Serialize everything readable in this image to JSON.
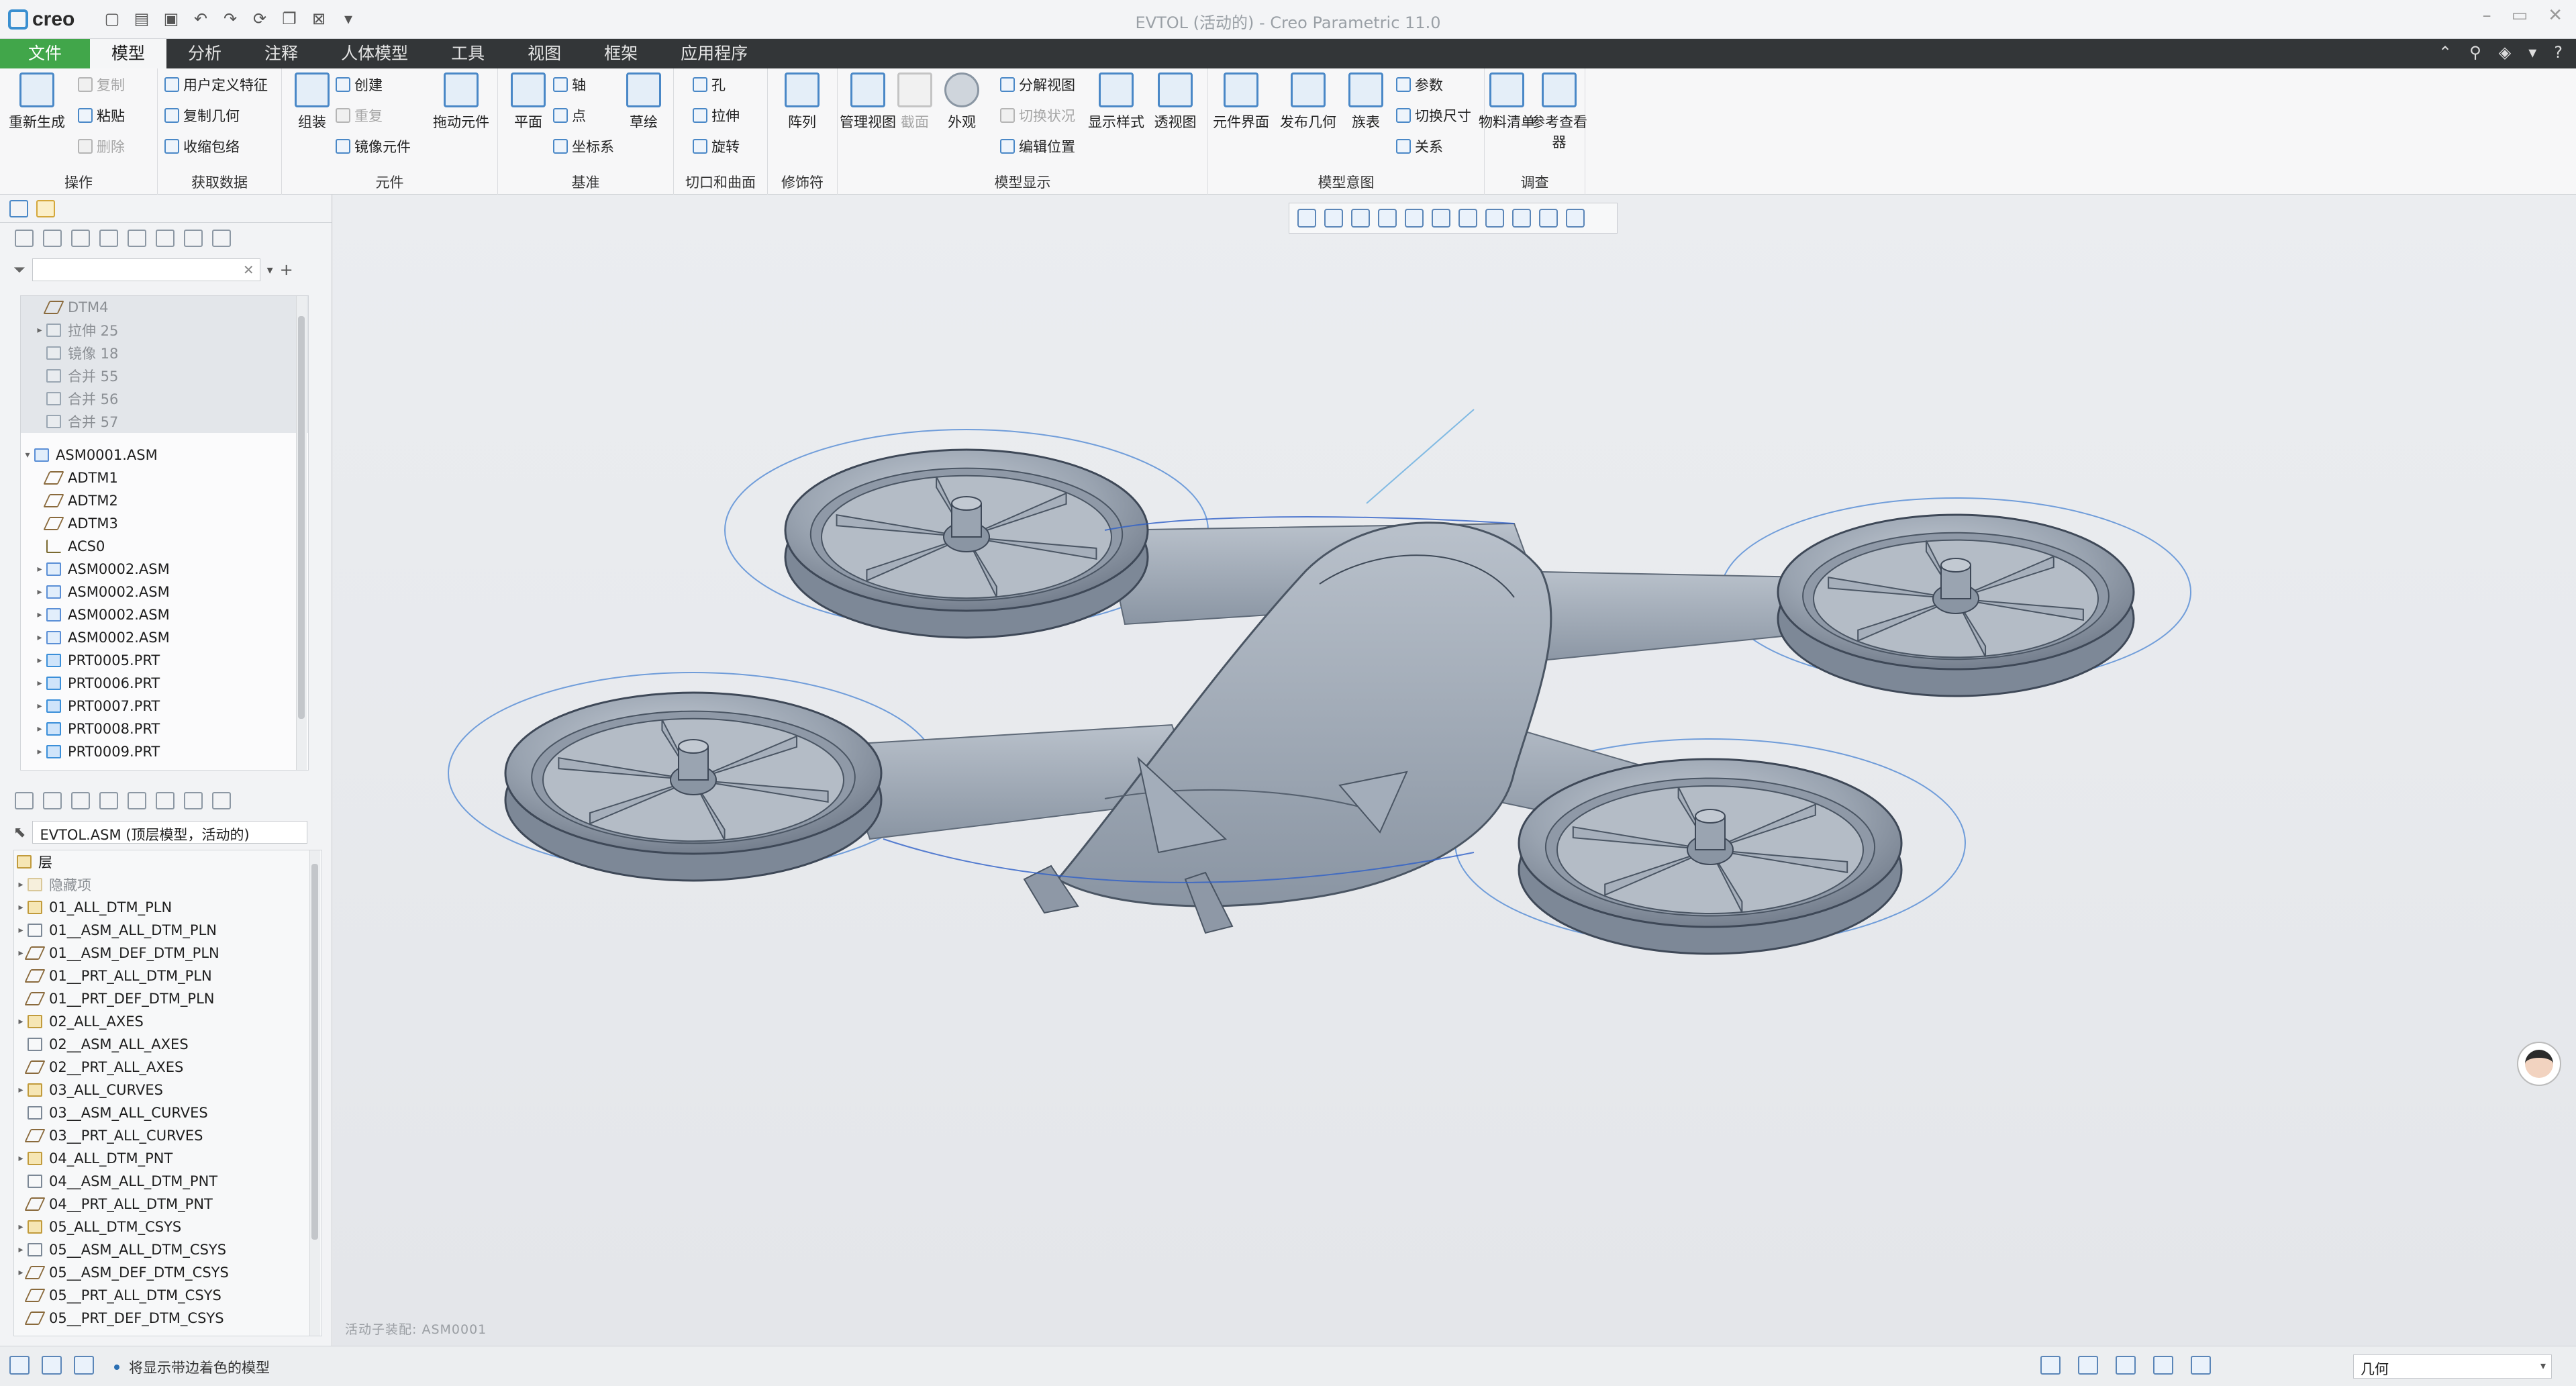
{
  "app": {
    "logo_text": "creo",
    "window_title": "EVTOL (活动的) - Creo Parametric 11.0"
  },
  "tabs": [
    "文件",
    "模型",
    "分析",
    "注释",
    "人体模型",
    "工具",
    "视图",
    "框架",
    "应用程序"
  ],
  "ribbon": {
    "groups": {
      "operations": "操作",
      "get_data": "获取数据",
      "component": "元件",
      "datum": "基准",
      "cut_surface": "切口和曲面",
      "modifiers": "修饰符",
      "model_display": "模型显示",
      "model_intent": "模型意图",
      "investigate": "调查"
    },
    "buttons": {
      "regenerate": "重新生成",
      "copy": "复制",
      "paste": "粘贴",
      "delete": "删除",
      "udf": "用户定义特征",
      "copy_geom": "复制几何",
      "shrinkwrap": "收缩包络",
      "assemble": "组装",
      "create": "创建",
      "repeat": "重复",
      "mirror_comp": "镜像元件",
      "drag_comp": "拖动元件",
      "plane": "平面",
      "axis": "轴",
      "point": "点",
      "csys": "坐标系",
      "sketch": "草绘",
      "hole": "孔",
      "extrude": "拉伸",
      "revolve": "旋转",
      "pattern": "阵列",
      "manage_views": "管理视图",
      "section": "截面",
      "appearance": "外观",
      "explode_view": "分解视图",
      "toggle_state": "切换状况",
      "edit_position": "编辑位置",
      "display_style": "显示样式",
      "perspective": "透视图",
      "comp_interface": "元件界面",
      "publish_geom": "发布几何",
      "family_table": "族表",
      "params": "参数",
      "switch_dims": "切换尺寸",
      "relations": "关系",
      "bom": "物料清单",
      "ref_viewer": "参考查看器"
    }
  },
  "model_tree": {
    "search_placeholder": "",
    "top_items": [
      {
        "label": "DTM4",
        "icon": "plane",
        "dim": true
      },
      {
        "label": "拉伸 25",
        "icon": "feat",
        "dim": true,
        "expandable": true
      },
      {
        "label": "镜像 18",
        "icon": "feat",
        "dim": true
      },
      {
        "label": "合并 55",
        "icon": "feat",
        "dim": true
      },
      {
        "label": "合并 56",
        "icon": "feat",
        "dim": true
      },
      {
        "label": "合并 57",
        "icon": "feat",
        "dim": true
      }
    ],
    "assembly": "ASM0001.ASM",
    "children": [
      {
        "label": "ADTM1",
        "icon": "plane"
      },
      {
        "label": "ADTM2",
        "icon": "plane"
      },
      {
        "label": "ADTM3",
        "icon": "plane"
      },
      {
        "label": "ACS0",
        "icon": "csys"
      },
      {
        "label": "ASM0002.ASM",
        "icon": "asm",
        "expandable": true
      },
      {
        "label": "ASM0002.ASM",
        "icon": "asm",
        "expandable": true
      },
      {
        "label": "ASM0002.ASM",
        "icon": "asm",
        "expandable": true
      },
      {
        "label": "ASM0002.ASM",
        "icon": "asm",
        "expandable": true
      },
      {
        "label": "PRT0005.PRT",
        "icon": "prt",
        "expandable": true
      },
      {
        "label": "PRT0006.PRT",
        "icon": "prt",
        "expandable": true
      },
      {
        "label": "PRT0007.PRT",
        "icon": "prt",
        "expandable": true
      },
      {
        "label": "PRT0008.PRT",
        "icon": "prt",
        "expandable": true
      },
      {
        "label": "PRT0009.PRT",
        "icon": "prt",
        "expandable": true
      }
    ]
  },
  "layer_tree": {
    "model_select": "EVTOL.ASM (顶层模型，活动的)",
    "root": "层",
    "items": [
      {
        "label": "隐藏项",
        "icon": "layerdim",
        "dim": true,
        "expandable": true
      },
      {
        "label": "01_ALL_DTM_PLN",
        "icon": "layer",
        "expandable": true
      },
      {
        "label": "01__ASM_ALL_DTM_PLN",
        "icon": "rule",
        "expandable": true
      },
      {
        "label": "01__ASM_DEF_DTM_PLN",
        "icon": "plane",
        "expandable": true
      },
      {
        "label": "01__PRT_ALL_DTM_PLN",
        "icon": "plane"
      },
      {
        "label": "01__PRT_DEF_DTM_PLN",
        "icon": "plane"
      },
      {
        "label": "02_ALL_AXES",
        "icon": "layer",
        "expandable": true
      },
      {
        "label": "02__ASM_ALL_AXES",
        "icon": "rule"
      },
      {
        "label": "02__PRT_ALL_AXES",
        "icon": "plane"
      },
      {
        "label": "03_ALL_CURVES",
        "icon": "layer",
        "expandable": true
      },
      {
        "label": "03__ASM_ALL_CURVES",
        "icon": "rule"
      },
      {
        "label": "03__PRT_ALL_CURVES",
        "icon": "plane"
      },
      {
        "label": "04_ALL_DTM_PNT",
        "icon": "layer",
        "expandable": true
      },
      {
        "label": "04__ASM_ALL_DTM_PNT",
        "icon": "rule"
      },
      {
        "label": "04__PRT_ALL_DTM_PNT",
        "icon": "plane"
      },
      {
        "label": "05_ALL_DTM_CSYS",
        "icon": "layer",
        "expandable": true
      },
      {
        "label": "05__ASM_ALL_DTM_CSYS",
        "icon": "rule",
        "expandable": true
      },
      {
        "label": "05__ASM_DEF_DTM_CSYS",
        "icon": "plane",
        "expandable": true
      },
      {
        "label": "05__PRT_ALL_DTM_CSYS",
        "icon": "plane"
      },
      {
        "label": "05__PRT_DEF_DTM_CSYS",
        "icon": "plane"
      }
    ]
  },
  "viewport": {
    "model_label": "活动子装配: ASM0001"
  },
  "status": {
    "message": "将显示带边着色的模型",
    "filter_value": "几何"
  }
}
